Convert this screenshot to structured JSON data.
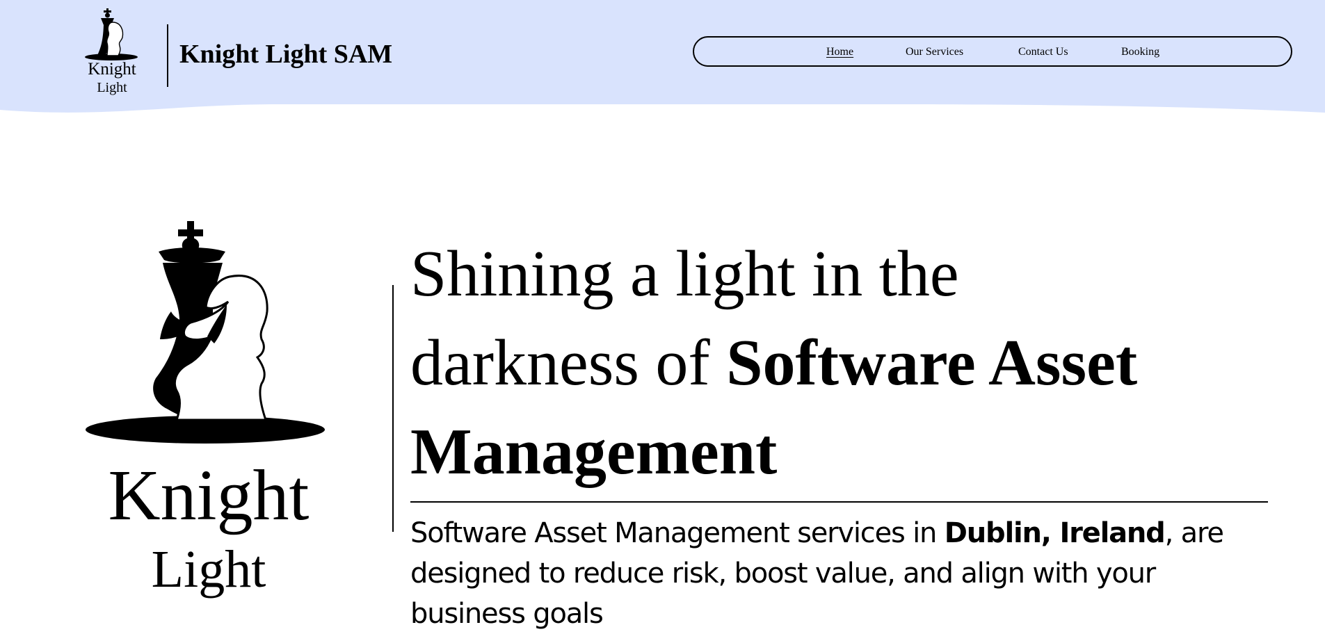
{
  "colors": {
    "header_background": "#d9e3fd",
    "text": "#000000",
    "page_background": "#ffffff"
  },
  "header": {
    "logo": {
      "word1": "Knight",
      "word2": "Light",
      "icon": "chess-king-knight-logo"
    },
    "brand_name": "Knight Light SAM",
    "nav": [
      {
        "label": "Home",
        "active": true
      },
      {
        "label": "Our Services",
        "active": false
      },
      {
        "label": "Contact Us",
        "active": false
      },
      {
        "label": "Booking",
        "active": false
      }
    ]
  },
  "hero": {
    "logo": {
      "word1": "Knight",
      "word2": "Light",
      "icon": "chess-king-knight-logo"
    },
    "headline": {
      "line1": "Shining a light in the",
      "line2_prefix": "darkness of ",
      "line2_bold": "Software Asset",
      "line3_bold": "Management"
    },
    "subtext": {
      "prefix": "Software Asset Management services in ",
      "bold": "Dublin, Ireland",
      "suffix": ", are designed to reduce risk, boost value, and align with your business goals"
    }
  }
}
